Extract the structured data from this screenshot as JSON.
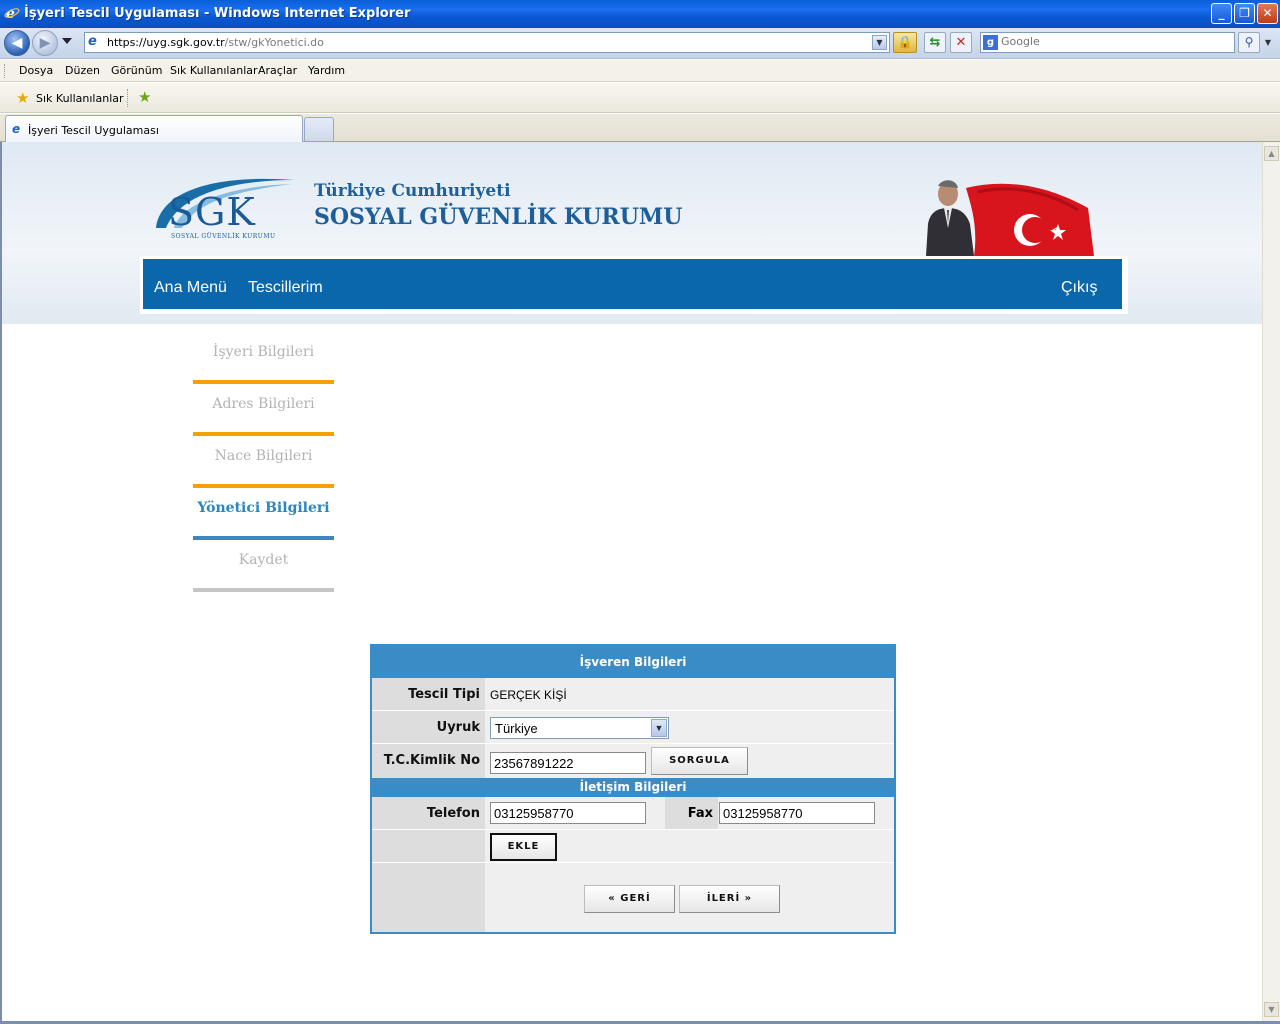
{
  "window": {
    "title": "İşyeri Tescil Uygulaması - Windows Internet Explorer",
    "minimize": "_",
    "maximize": "❐",
    "close": "✕"
  },
  "address": {
    "url_main": "https://uyg.sgk.gov.tr",
    "url_path": "/stw/gkYonetici.do",
    "search_placeholder": "Google"
  },
  "menubar": {
    "items": [
      "Dosya",
      "Düzen",
      "Görünüm",
      "Sık Kullanılanlar",
      "Araçlar",
      "Yardım"
    ]
  },
  "favbar": {
    "favorites_label": "Sık Kullanılanlar"
  },
  "tab": {
    "label": "İşyeri Tescil Uygulaması"
  },
  "header": {
    "logo_text": "SGK",
    "logo_sub": "SOSYAL GÜVENLİK KURUMU",
    "org_line1": "Türkiye Cumhuriyeti",
    "org_line2": "SOSYAL GÜVENLİK KURUMU"
  },
  "nav": {
    "main_menu": "Ana Menü",
    "registrations": "Tescillerim",
    "logout": "Çıkış"
  },
  "steps": [
    {
      "label": "İşyeri Bilgileri",
      "state": "done"
    },
    {
      "label": "Adres Bilgileri",
      "state": "done"
    },
    {
      "label": "Nace Bilgileri",
      "state": "done"
    },
    {
      "label": "Yönetici Bilgileri",
      "state": "active"
    },
    {
      "label": "Kaydet",
      "state": "pending"
    }
  ],
  "form": {
    "title": "İşveren Bilgileri",
    "registration_type_label": "Tescil Tipi",
    "registration_type_value": "GERÇEK KİŞİ",
    "nationality_label": "Uyruk",
    "nationality_value": "Türkiye",
    "tc_label": "T.C.Kimlik No",
    "tc_value": "23567891222",
    "query_button": "SORGULA",
    "contact_title": "İletişim Bilgileri",
    "phone_label": "Telefon",
    "phone_value": "03125958770",
    "fax_label": "Fax",
    "fax_value": "03125958770",
    "add_button": "EKLE",
    "back_button": "« GERİ",
    "next_button": "İLERİ »"
  },
  "colors": {
    "nav_blue": "#0a67ac",
    "form_blue": "#3a8cc6",
    "step_done": "#f5a200",
    "step_active": "#3a87c4"
  }
}
